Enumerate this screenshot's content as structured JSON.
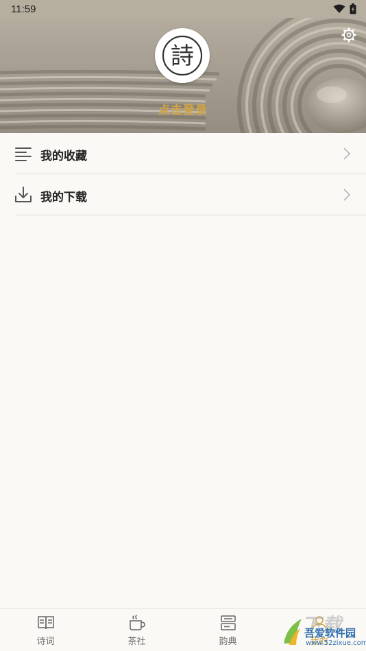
{
  "status_bar": {
    "time": "11:59"
  },
  "profile": {
    "login_label": "点击登录",
    "avatar_glyph": "詩"
  },
  "menu": [
    {
      "label": "我的收藏",
      "icon": "list-icon"
    },
    {
      "label": "我的下载",
      "icon": "download-icon"
    }
  ],
  "tabbar": [
    {
      "label": "诗词",
      "icon": "book-icon"
    },
    {
      "label": "茶社",
      "icon": "tea-cup-icon"
    },
    {
      "label": "韵典",
      "icon": "dictionary-icon"
    },
    {
      "label": "我的",
      "icon": "profile-icon"
    }
  ],
  "watermark": {
    "big_text": "下载",
    "site_name": "吾爱软件园",
    "site_url": "www.52zixue.com"
  },
  "colors": {
    "accent": "#d1a648",
    "background": "#faf9f6",
    "divider": "#e2e0dc"
  }
}
